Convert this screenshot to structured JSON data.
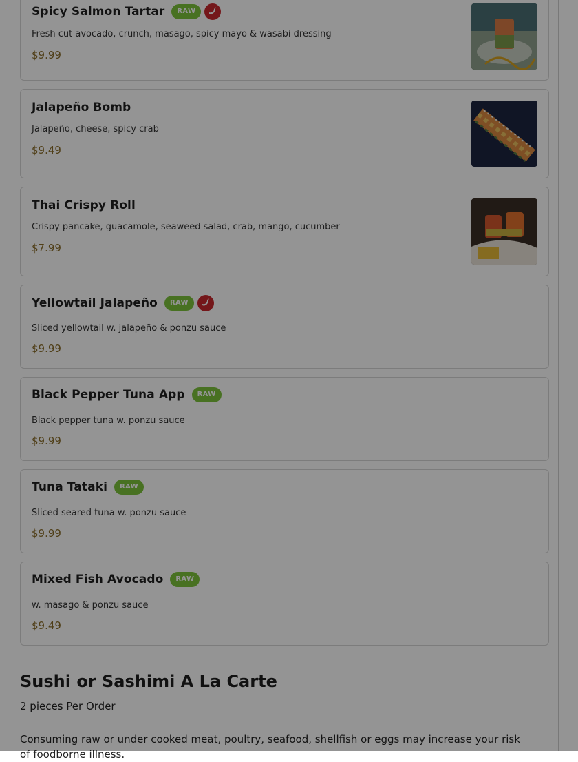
{
  "items": [
    {
      "name": "Spicy Salmon Tartar",
      "raw": "RAW",
      "desc": "Fresh cut avocado, crunch, masago, spicy mayo & wasabi dressing",
      "price": "$9.99"
    },
    {
      "name": "Jalapeño Bomb",
      "desc": "Jalapeño, cheese, spicy crab",
      "price": "$9.49"
    },
    {
      "name": "Thai Crispy Roll",
      "desc": "Crispy pancake, guacamole, seaweed salad, crab, mango, cucumber",
      "price": "$7.99"
    },
    {
      "name": "Yellowtail Jalapeño",
      "raw": "RAW",
      "desc": "Sliced yellowtail w. jalapeño & ponzu sauce",
      "price": "$9.99"
    },
    {
      "name": "Black Pepper Tuna App",
      "raw": "RAW",
      "desc": "Black pepper tuna w. ponzu sauce",
      "price": "$9.99"
    },
    {
      "name": "Tuna Tataki",
      "raw": "RAW",
      "desc": "Sliced seared tuna w. ponzu sauce",
      "price": "$9.99"
    },
    {
      "name": "Mixed Fish Avocado",
      "raw": "RAW",
      "desc": "w. masago & ponzu sauce",
      "price": "$9.49"
    }
  ],
  "section": {
    "title": "Sushi or Sashimi A La Carte",
    "subtitle": "2 pieces Per Order",
    "disclaimer": "Consuming raw or under cooked meat, poultry, seafood, shellfish or eggs may increase your risk of foodborne illness."
  }
}
